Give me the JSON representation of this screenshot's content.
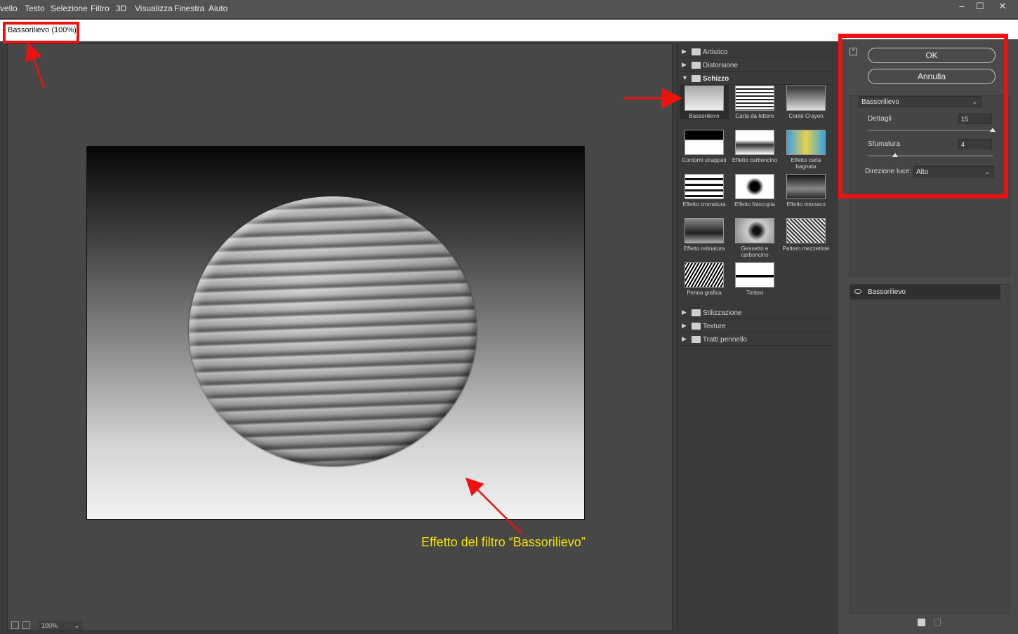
{
  "menu": [
    "vello",
    "Testo",
    "Selezione",
    "Filtro",
    "3D",
    "Visualizza",
    "Finestra",
    "Aiuto"
  ],
  "window_controls": {
    "minimize": "–",
    "maximize": "☐",
    "close": "✕"
  },
  "document": {
    "title": "Bassorilievo (100%)"
  },
  "status": {
    "zoom": "100%"
  },
  "gallery": {
    "categories_top": [
      {
        "label": "Artistico",
        "expanded": false
      },
      {
        "label": "Distorsione",
        "expanded": false
      },
      {
        "label": "Schizzo",
        "expanded": true
      }
    ],
    "filters": [
      {
        "label": "Bassorilievo",
        "selected": true
      },
      {
        "label": "Carta da lettere",
        "selected": false
      },
      {
        "label": "Conté Crayon",
        "selected": false
      },
      {
        "label": "Contorni strappati",
        "selected": false
      },
      {
        "label": "Effetto carboncino",
        "selected": false
      },
      {
        "label": "Effetto carta bagnata",
        "selected": false
      },
      {
        "label": "Effetto cromatura",
        "selected": false
      },
      {
        "label": "Effetto fotocopia",
        "selected": false
      },
      {
        "label": "Effetto intonaco",
        "selected": false
      },
      {
        "label": "Effetto retinatura",
        "selected": false
      },
      {
        "label": "Gessetto e carboncino",
        "selected": false
      },
      {
        "label": "Pattern mezzetinte",
        "selected": false
      },
      {
        "label": "Penna grafica",
        "selected": false
      },
      {
        "label": "Timbro",
        "selected": false
      }
    ],
    "categories_bottom": [
      {
        "label": "Stilizzazione",
        "expanded": false
      },
      {
        "label": "Texture",
        "expanded": false
      },
      {
        "label": "Tratti pennello",
        "expanded": false
      }
    ]
  },
  "options": {
    "ok_label": "OK",
    "cancel_label": "Annulla",
    "filter_select": "Bassorilievo",
    "params": [
      {
        "label": "Dettagli",
        "value": "15",
        "fraction": 1.0
      },
      {
        "label": "Sfumatura",
        "value": "4",
        "fraction": 0.2
      }
    ],
    "light_direction_label": "Direzione luce:",
    "light_direction_value": "Alto"
  },
  "layers": [
    {
      "name": "Bassorilievo",
      "visible": true
    }
  ],
  "annotation": {
    "caption": "Effetto del filtro “Bassorilievo”",
    "color": "#ee1111"
  },
  "icons": {
    "collapse": "collapse-panel-icon",
    "new_layer": "new-effect-layer-icon",
    "delete": "trash-icon"
  }
}
